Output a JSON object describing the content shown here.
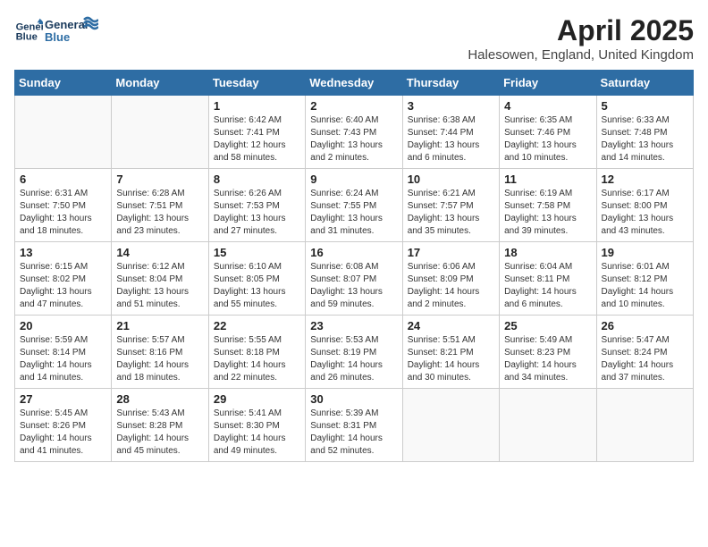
{
  "logo": {
    "line1": "General",
    "line2": "Blue"
  },
  "title": "April 2025",
  "location": "Halesowen, England, United Kingdom",
  "days_of_week": [
    "Sunday",
    "Monday",
    "Tuesday",
    "Wednesday",
    "Thursday",
    "Friday",
    "Saturday"
  ],
  "weeks": [
    [
      {
        "day": "",
        "info": ""
      },
      {
        "day": "",
        "info": ""
      },
      {
        "day": "1",
        "info": "Sunrise: 6:42 AM\nSunset: 7:41 PM\nDaylight: 12 hours\nand 58 minutes."
      },
      {
        "day": "2",
        "info": "Sunrise: 6:40 AM\nSunset: 7:43 PM\nDaylight: 13 hours\nand 2 minutes."
      },
      {
        "day": "3",
        "info": "Sunrise: 6:38 AM\nSunset: 7:44 PM\nDaylight: 13 hours\nand 6 minutes."
      },
      {
        "day": "4",
        "info": "Sunrise: 6:35 AM\nSunset: 7:46 PM\nDaylight: 13 hours\nand 10 minutes."
      },
      {
        "day": "5",
        "info": "Sunrise: 6:33 AM\nSunset: 7:48 PM\nDaylight: 13 hours\nand 14 minutes."
      }
    ],
    [
      {
        "day": "6",
        "info": "Sunrise: 6:31 AM\nSunset: 7:50 PM\nDaylight: 13 hours\nand 18 minutes."
      },
      {
        "day": "7",
        "info": "Sunrise: 6:28 AM\nSunset: 7:51 PM\nDaylight: 13 hours\nand 23 minutes."
      },
      {
        "day": "8",
        "info": "Sunrise: 6:26 AM\nSunset: 7:53 PM\nDaylight: 13 hours\nand 27 minutes."
      },
      {
        "day": "9",
        "info": "Sunrise: 6:24 AM\nSunset: 7:55 PM\nDaylight: 13 hours\nand 31 minutes."
      },
      {
        "day": "10",
        "info": "Sunrise: 6:21 AM\nSunset: 7:57 PM\nDaylight: 13 hours\nand 35 minutes."
      },
      {
        "day": "11",
        "info": "Sunrise: 6:19 AM\nSunset: 7:58 PM\nDaylight: 13 hours\nand 39 minutes."
      },
      {
        "day": "12",
        "info": "Sunrise: 6:17 AM\nSunset: 8:00 PM\nDaylight: 13 hours\nand 43 minutes."
      }
    ],
    [
      {
        "day": "13",
        "info": "Sunrise: 6:15 AM\nSunset: 8:02 PM\nDaylight: 13 hours\nand 47 minutes."
      },
      {
        "day": "14",
        "info": "Sunrise: 6:12 AM\nSunset: 8:04 PM\nDaylight: 13 hours\nand 51 minutes."
      },
      {
        "day": "15",
        "info": "Sunrise: 6:10 AM\nSunset: 8:05 PM\nDaylight: 13 hours\nand 55 minutes."
      },
      {
        "day": "16",
        "info": "Sunrise: 6:08 AM\nSunset: 8:07 PM\nDaylight: 13 hours\nand 59 minutes."
      },
      {
        "day": "17",
        "info": "Sunrise: 6:06 AM\nSunset: 8:09 PM\nDaylight: 14 hours\nand 2 minutes."
      },
      {
        "day": "18",
        "info": "Sunrise: 6:04 AM\nSunset: 8:11 PM\nDaylight: 14 hours\nand 6 minutes."
      },
      {
        "day": "19",
        "info": "Sunrise: 6:01 AM\nSunset: 8:12 PM\nDaylight: 14 hours\nand 10 minutes."
      }
    ],
    [
      {
        "day": "20",
        "info": "Sunrise: 5:59 AM\nSunset: 8:14 PM\nDaylight: 14 hours\nand 14 minutes."
      },
      {
        "day": "21",
        "info": "Sunrise: 5:57 AM\nSunset: 8:16 PM\nDaylight: 14 hours\nand 18 minutes."
      },
      {
        "day": "22",
        "info": "Sunrise: 5:55 AM\nSunset: 8:18 PM\nDaylight: 14 hours\nand 22 minutes."
      },
      {
        "day": "23",
        "info": "Sunrise: 5:53 AM\nSunset: 8:19 PM\nDaylight: 14 hours\nand 26 minutes."
      },
      {
        "day": "24",
        "info": "Sunrise: 5:51 AM\nSunset: 8:21 PM\nDaylight: 14 hours\nand 30 minutes."
      },
      {
        "day": "25",
        "info": "Sunrise: 5:49 AM\nSunset: 8:23 PM\nDaylight: 14 hours\nand 34 minutes."
      },
      {
        "day": "26",
        "info": "Sunrise: 5:47 AM\nSunset: 8:24 PM\nDaylight: 14 hours\nand 37 minutes."
      }
    ],
    [
      {
        "day": "27",
        "info": "Sunrise: 5:45 AM\nSunset: 8:26 PM\nDaylight: 14 hours\nand 41 minutes."
      },
      {
        "day": "28",
        "info": "Sunrise: 5:43 AM\nSunset: 8:28 PM\nDaylight: 14 hours\nand 45 minutes."
      },
      {
        "day": "29",
        "info": "Sunrise: 5:41 AM\nSunset: 8:30 PM\nDaylight: 14 hours\nand 49 minutes."
      },
      {
        "day": "30",
        "info": "Sunrise: 5:39 AM\nSunset: 8:31 PM\nDaylight: 14 hours\nand 52 minutes."
      },
      {
        "day": "",
        "info": ""
      },
      {
        "day": "",
        "info": ""
      },
      {
        "day": "",
        "info": ""
      }
    ]
  ]
}
